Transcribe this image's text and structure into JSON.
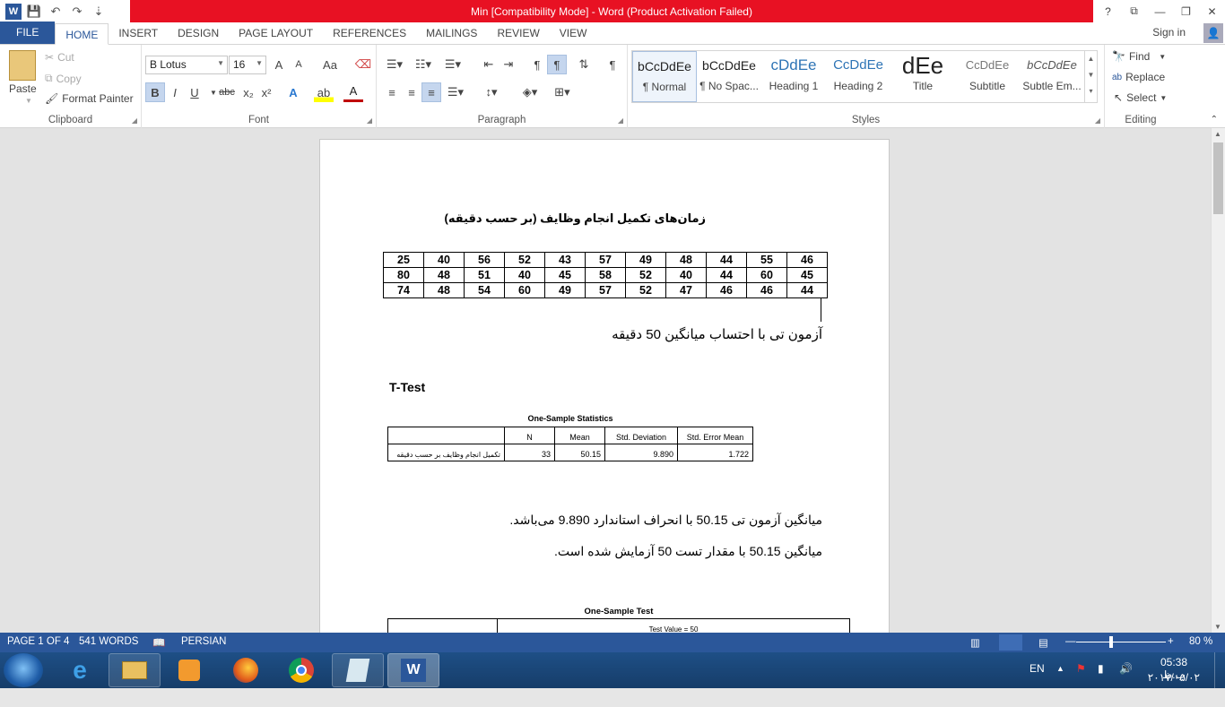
{
  "window": {
    "title": "Min [Compatibility Mode] -  Word (Product Activation Failed)",
    "help": "?",
    "ribbon_display": "⧉",
    "minimize": "—",
    "restore": "❐",
    "close": "✕"
  },
  "qat": {
    "word_icon": "W",
    "save": "💾",
    "undo": "↶",
    "redo": "↷",
    "customize": "⇣"
  },
  "tabs": [
    "FILE",
    "HOME",
    "INSERT",
    "DESIGN",
    "PAGE LAYOUT",
    "REFERENCES",
    "MAILINGS",
    "REVIEW",
    "VIEW"
  ],
  "signin": "Sign in",
  "clipboard": {
    "paste": "Paste",
    "cut": "Cut",
    "copy": "Copy",
    "format_painter": "Format Painter",
    "label": "Clipboard"
  },
  "font": {
    "name": "B Lotus",
    "size": "16",
    "label": "Font",
    "grow": "A",
    "shrink": "A",
    "case": "Aa",
    "bold": "B",
    "italic": "I",
    "underline": "U",
    "strike": "abc",
    "sub": "x₂",
    "sup": "x²",
    "effects": "A",
    "highlight": "ab",
    "color": "A"
  },
  "paragraph": {
    "label": "Paragraph",
    "pilcrow": "¶"
  },
  "styles": {
    "label": "Styles",
    "items": [
      {
        "preview": "bCcDdEe",
        "name": "¶ Normal"
      },
      {
        "preview": "bCcDdEe",
        "name": "¶ No Spac..."
      },
      {
        "preview": "cDdEe",
        "name": "Heading 1"
      },
      {
        "preview": "CcDdEe",
        "name": "Heading 2"
      },
      {
        "preview": "dEe",
        "name": "Title"
      },
      {
        "preview": "CcDdEe",
        "name": "Subtitle"
      },
      {
        "preview": "bCcDdEe",
        "name": "Subtle Em..."
      }
    ]
  },
  "editing": {
    "find": "Find",
    "replace": "Replace",
    "select": "Select",
    "label": "Editing"
  },
  "doc": {
    "heading": "زمان‌های تکمیل انجام وظایف (بر حسب دقیقه)",
    "data_rows": [
      [
        "46",
        "55",
        "44",
        "48",
        "49",
        "57",
        "43",
        "52",
        "56",
        "40",
        "25"
      ],
      [
        "45",
        "60",
        "44",
        "40",
        "52",
        "58",
        "45",
        "40",
        "51",
        "48",
        "80"
      ],
      [
        "44",
        "46",
        "46",
        "47",
        "52",
        "57",
        "49",
        "60",
        "54",
        "48",
        "74"
      ]
    ],
    "ttest_intro": "آزمون تی با احتساب میانگین 50 دقیقه",
    "ttest_title": "T-Test",
    "stats_title": "One-Sample Statistics",
    "stats_headers": [
      "",
      "N",
      "Mean",
      "Std. Deviation",
      "Std. Error Mean"
    ],
    "stats_row": [
      "تکمیل انجام وظایف بر حسب دقیقه",
      "33",
      "50.15",
      "9.890",
      "1.722"
    ],
    "para1": "میانگین آزمون تی 50.15 با انحراف استاندارد  9.890 می‌باشد.",
    "para2": "میانگین  50.15 با مقدار تست 50 آزمایش شده است.",
    "test_title": "One-Sample Test",
    "test_value": "Test Value = 50"
  },
  "status": {
    "page": "PAGE 1 OF 4",
    "words": "541 WORDS",
    "lang": "PERSIAN",
    "zoom": "80 %"
  },
  "tray": {
    "lang": "EN",
    "time": "05:38 ب.ظ",
    "date": "۲۰۱۷/۰۵/۰۲"
  },
  "colors": {
    "accent": "#2b579a",
    "title_band": "#e81123"
  }
}
